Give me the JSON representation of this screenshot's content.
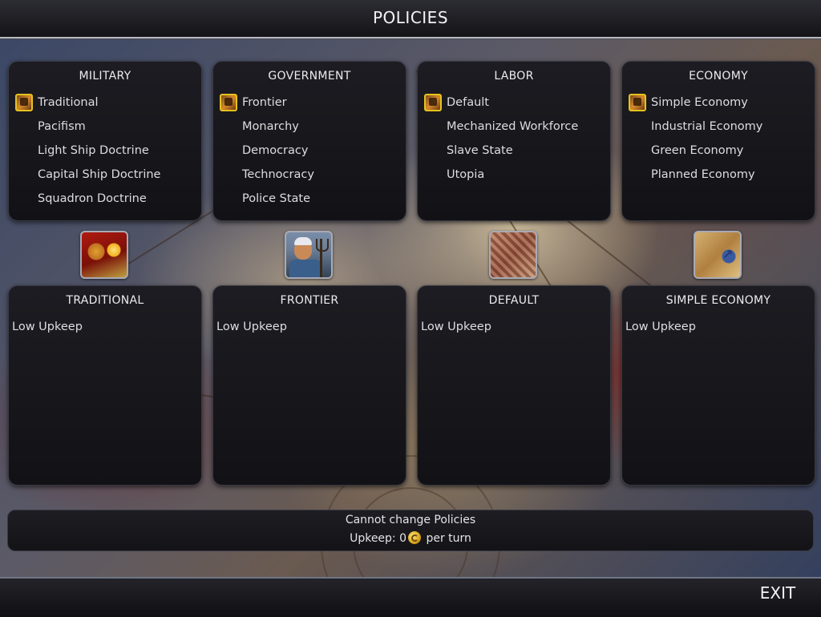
{
  "header": {
    "title": "POLICIES"
  },
  "categories": [
    {
      "title": "MILITARY",
      "options": [
        "Traditional",
        "Pacifism",
        "Light Ship Doctrine",
        "Capital Ship Doctrine",
        "Squadron Doctrine"
      ],
      "selected": "Traditional",
      "detail_title": "TRADITIONAL",
      "detail_text": "Low Upkeep",
      "portrait": "horn-icon"
    },
    {
      "title": "GOVERNMENT",
      "options": [
        "Frontier",
        "Monarchy",
        "Democracy",
        "Technocracy",
        "Police State"
      ],
      "selected": "Frontier",
      "detail_title": "FRONTIER",
      "detail_text": "Low Upkeep",
      "portrait": "pitchfork-farmer-icon"
    },
    {
      "title": "LABOR",
      "options": [
        "Default",
        "Mechanized Workforce",
        "Slave State",
        "Utopia"
      ],
      "selected": "Default",
      "detail_title": "DEFAULT",
      "detail_text": "Low Upkeep",
      "portrait": "bricks-icon"
    },
    {
      "title": "ECONOMY",
      "options": [
        "Simple Economy",
        "Industrial Economy",
        "Green Economy",
        "Planned Economy"
      ],
      "selected": "Simple Economy",
      "detail_title": "SIMPLE ECONOMY",
      "detail_text": "Low Upkeep",
      "portrait": "map-scroll-icon"
    }
  ],
  "status": {
    "line1": "Cannot change Policies",
    "upkeep_prefix": "Upkeep: 0",
    "upkeep_suffix": "per turn",
    "currency_icon": "credit-coin-icon"
  },
  "footer": {
    "exit_label": "EXIT"
  },
  "colors": {
    "selection_border": "#e6c21f",
    "panel_bg": "#16161b",
    "bar_border": "#b9b9c2"
  }
}
